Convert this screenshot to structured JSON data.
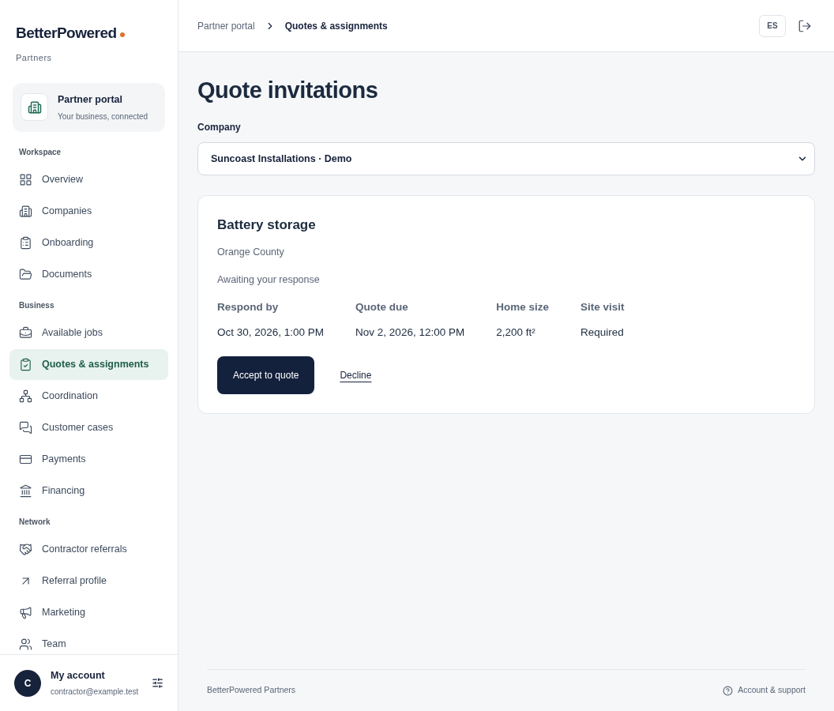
{
  "brand": {
    "name": "BetterPowered",
    "subtitle": "Partners"
  },
  "portal_card": {
    "title": "Partner portal",
    "subtitle": "Your business, connected"
  },
  "sidebar": {
    "sections": [
      {
        "heading": "Workspace",
        "items": [
          {
            "label": "Overview",
            "selected": false
          },
          {
            "label": "Companies",
            "selected": false
          },
          {
            "label": "Onboarding",
            "selected": false
          },
          {
            "label": "Documents",
            "selected": false
          }
        ]
      },
      {
        "heading": "Business",
        "items": [
          {
            "label": "Available jobs",
            "selected": false
          },
          {
            "label": "Quotes & assignments",
            "selected": true
          },
          {
            "label": "Coordination",
            "selected": false
          },
          {
            "label": "Customer cases",
            "selected": false
          },
          {
            "label": "Payments",
            "selected": false
          },
          {
            "label": "Financing",
            "selected": false
          }
        ]
      },
      {
        "heading": "Network",
        "items": [
          {
            "label": "Contractor referrals",
            "selected": false
          },
          {
            "label": "Referral profile",
            "selected": false
          },
          {
            "label": "Marketing",
            "selected": false
          },
          {
            "label": "Team",
            "selected": false
          }
        ]
      }
    ]
  },
  "account": {
    "initial": "C",
    "name": "My account",
    "email": "contractor@example.test"
  },
  "breadcrumb": [
    "Partner portal",
    "Quotes & assignments"
  ],
  "language_button": "ES",
  "page_title": "Quote invitations",
  "company_field": {
    "label": "Company",
    "value": "Suncoast Installations · Demo"
  },
  "invitation": {
    "title": "Battery storage",
    "location": "Orange County",
    "status": "Awaiting your response",
    "details": [
      {
        "label": "Respond by",
        "value": "Oct 30, 2026, 1:00 PM"
      },
      {
        "label": "Quote due",
        "value": "Nov 2, 2026, 12:00 PM"
      },
      {
        "label": "Home size",
        "value": "2,200 ft²"
      },
      {
        "label": "Site visit",
        "value": "Required"
      }
    ],
    "accept_button": "Accept to quote",
    "decline_link": "Decline"
  },
  "footer": {
    "left": "BetterPowered Partners",
    "support_link": "Account & support"
  }
}
